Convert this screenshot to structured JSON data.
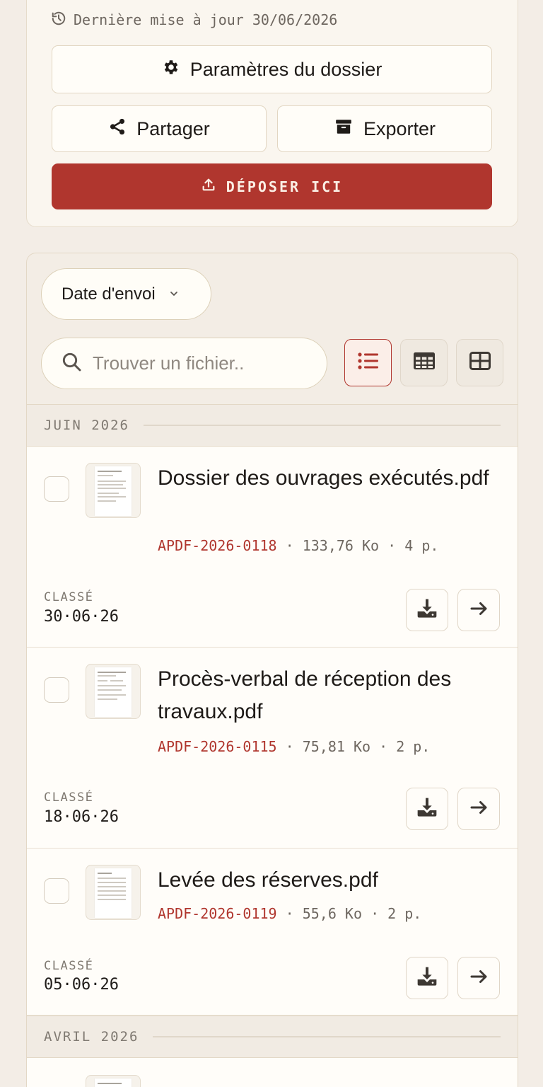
{
  "header": {
    "updated_label": "Dernière mise à jour 30/06/2026",
    "settings_label": "Paramètres du dossier",
    "share_label": "Partager",
    "export_label": "Exporter",
    "upload_label": "DÉPOSER ICI"
  },
  "toolbar": {
    "sort_label": "Date d'envoi",
    "search_placeholder": "Trouver un fichier.."
  },
  "sections": [
    {
      "label": "JUIN 2026",
      "files": [
        {
          "name": "Dossier des ouvrages exécutés.pdf",
          "ref": "APDF-2026-0118",
          "size": "133,76 Ko",
          "pages": "4 p.",
          "classed_label": "CLASSÉ",
          "date": "30·06·26"
        },
        {
          "name": "Procès-verbal de réception des travaux.pdf",
          "ref": "APDF-2026-0115",
          "size": "75,81 Ko",
          "pages": "2 p.",
          "classed_label": "CLASSÉ",
          "date": "18·06·26"
        },
        {
          "name": "Levée des réserves.pdf",
          "ref": "APDF-2026-0119",
          "size": "55,6 Ko",
          "pages": "2 p.",
          "classed_label": "CLASSÉ",
          "date": "05·06·26"
        }
      ]
    },
    {
      "label": "AVRIL 2026",
      "files": []
    }
  ],
  "colors": {
    "accent": "#b0362e",
    "background": "#f3ede6",
    "card": "#fffdf9"
  }
}
